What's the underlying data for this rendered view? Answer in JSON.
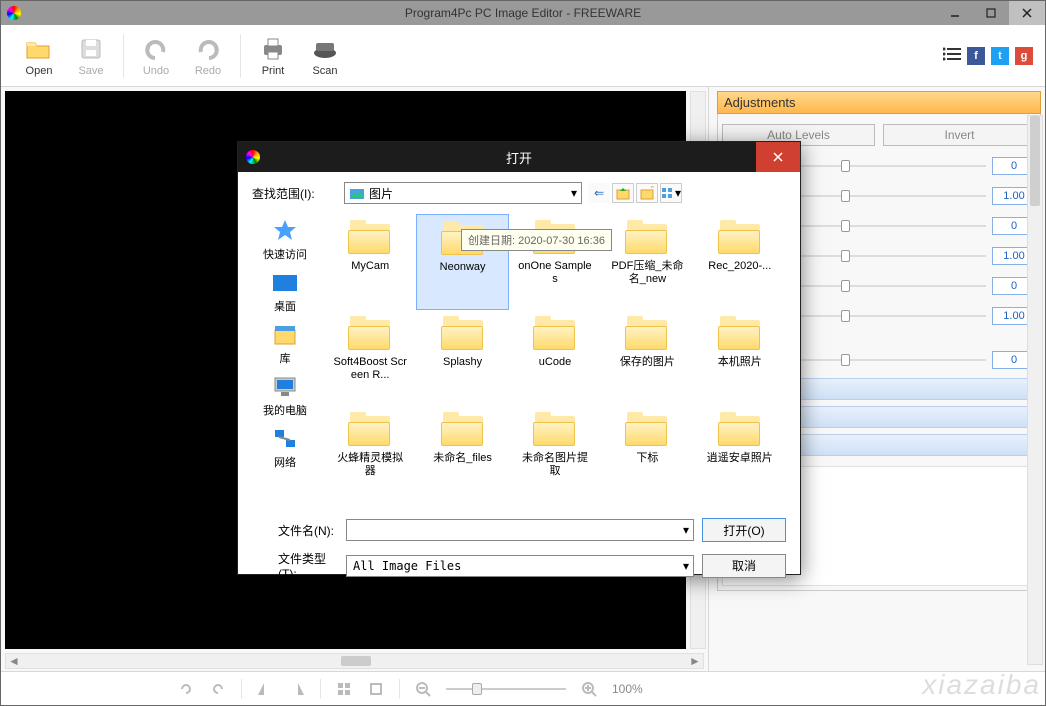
{
  "app": {
    "title": "Program4Pc PC Image Editor - FREEWARE"
  },
  "toolbar": {
    "open": "Open",
    "save": "Save",
    "undo": "Undo",
    "redo": "Redo",
    "print": "Print",
    "scan": "Scan"
  },
  "adjustments": {
    "header": "Adjustments",
    "auto_levels": "Auto Levels",
    "invert": "Invert",
    "sliders": [
      {
        "value": "0"
      },
      {
        "value": "1.00"
      },
      {
        "value": "0"
      },
      {
        "value": "1.00"
      },
      {
        "value": "0"
      },
      {
        "value": "1.00"
      },
      {
        "value": "0"
      }
    ]
  },
  "status": {
    "zoom": "100%"
  },
  "dialog": {
    "title": "打开",
    "look_in_label": "查找范围(I):",
    "look_in_value": "图片",
    "sidebar": [
      {
        "label": "快速访问"
      },
      {
        "label": "桌面"
      },
      {
        "label": "库"
      },
      {
        "label": "我的电脑"
      },
      {
        "label": "网络"
      }
    ],
    "files": [
      {
        "name": "MyCam"
      },
      {
        "name": "Neonway",
        "selected": true
      },
      {
        "name": "onOne Samples"
      },
      {
        "name": "PDF压缩_未命名_new"
      },
      {
        "name": "Rec_2020-..."
      },
      {
        "name": "Soft4Boost Screen R..."
      },
      {
        "name": "Splashy"
      },
      {
        "name": "uCode"
      },
      {
        "name": "保存的图片"
      },
      {
        "name": "本机照片"
      },
      {
        "name": "火蜂精灵模拟器"
      },
      {
        "name": "未命名_files"
      },
      {
        "name": "未命名图片提取"
      },
      {
        "name": "下标"
      },
      {
        "name": "逍遥安卓照片"
      }
    ],
    "filename_label": "文件名(N):",
    "filename_value": "",
    "filetype_label": "文件类型(T):",
    "filetype_value": "All Image Files",
    "open_btn": "打开(O)",
    "cancel_btn": "取消",
    "tooltip": "创建日期: 2020-07-30 16:36"
  }
}
